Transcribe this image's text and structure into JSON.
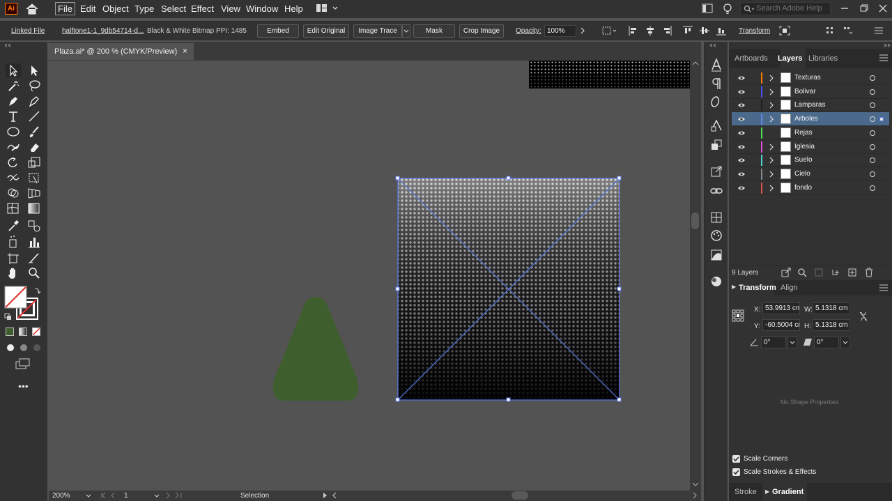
{
  "app": {
    "logo": "Ai"
  },
  "menu": [
    "File",
    "Edit",
    "Object",
    "Type",
    "Select",
    "Effect",
    "View",
    "Window",
    "Help"
  ],
  "search": {
    "placeholder": "Search Adobe Help"
  },
  "control_bar": {
    "linked_file": "Linked File",
    "filename": "halftone1-1_9db54714-d...",
    "bitmap_type": "Black & White Bitmap",
    "ppi": "PPI: 1485",
    "embed": "Embed",
    "edit_original": "Edit Original",
    "image_trace": "Image Trace",
    "mask": "Mask",
    "crop_image": "Crop Image",
    "opacity_label": "Opacity:",
    "opacity_value": "100%",
    "transform": "Transform"
  },
  "document": {
    "tab_title": "Plaza.ai* @ 200 % (CMYK/Preview)",
    "close": "×"
  },
  "status": {
    "zoom": "200%",
    "artboard": "1",
    "tool": "Selection"
  },
  "panels": {
    "tabs": [
      "Artboards",
      "Layers",
      "Libraries"
    ],
    "active_tab": "Layers",
    "layers": [
      {
        "name": "Texturas",
        "color": "#ff7f00",
        "expandable": true,
        "selected": false
      },
      {
        "name": "Bolivar",
        "color": "#4f4fff",
        "expandable": true,
        "selected": false
      },
      {
        "name": "Lamparas",
        "color": "#202020",
        "expandable": true,
        "selected": false
      },
      {
        "name": "Arboles",
        "color": "#5b8ce8",
        "expandable": true,
        "selected": true
      },
      {
        "name": "Rejas",
        "color": "#4fe04f",
        "expandable": false,
        "selected": false
      },
      {
        "name": "Iglesia",
        "color": "#e94fe0",
        "expandable": true,
        "selected": false
      },
      {
        "name": "Suelo",
        "color": "#4fd6d6",
        "expandable": true,
        "selected": false
      },
      {
        "name": "Cielo",
        "color": "#888888",
        "expandable": true,
        "selected": false
      },
      {
        "name": "fondo",
        "color": "#e04f4f",
        "expandable": true,
        "selected": false
      }
    ],
    "layer_count": "9 Layers",
    "transform_tabs": [
      "Transform",
      "Align"
    ],
    "transform": {
      "x_label": "X:",
      "x": "53.9913 cm",
      "y_label": "Y:",
      "y": "-60.5004 cm",
      "w_label": "W:",
      "w": "5.1318 cm",
      "h_label": "H:",
      "h": "5.1318 cm",
      "rotate": "0°",
      "shear": "0°"
    },
    "no_shape": "No Shape Properties",
    "scale_corners": "Scale Corners",
    "scale_strokes": "Scale Strokes & Effects",
    "bottom_tabs": [
      "Stroke",
      "Gradient"
    ]
  },
  "colors": {
    "tree": "#3f5e2d",
    "selection": "#5b79e8"
  }
}
